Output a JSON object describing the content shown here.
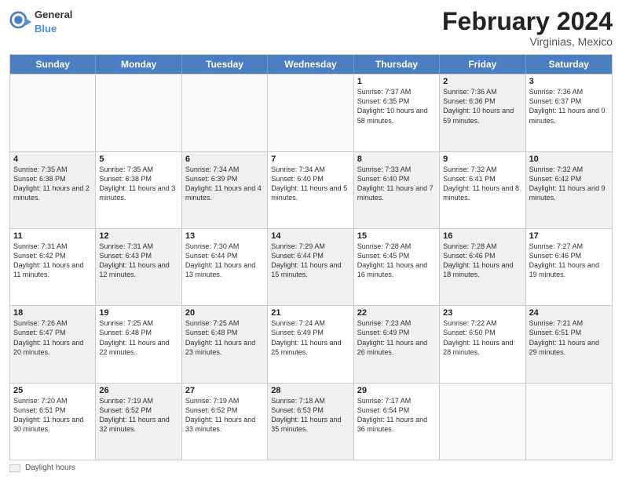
{
  "header": {
    "logo_general": "General",
    "logo_blue": "Blue",
    "month_title": "February 2024",
    "subtitle": "Virginias, Mexico"
  },
  "calendar": {
    "days_of_week": [
      "Sunday",
      "Monday",
      "Tuesday",
      "Wednesday",
      "Thursday",
      "Friday",
      "Saturday"
    ],
    "weeks": [
      [
        {
          "day": "",
          "info": "",
          "empty": true
        },
        {
          "day": "",
          "info": "",
          "empty": true
        },
        {
          "day": "",
          "info": "",
          "empty": true
        },
        {
          "day": "",
          "info": "",
          "empty": true
        },
        {
          "day": "1",
          "info": "Sunrise: 7:37 AM\nSunset: 6:35 PM\nDaylight: 10 hours\nand 58 minutes.",
          "shaded": false
        },
        {
          "day": "2",
          "info": "Sunrise: 7:36 AM\nSunset: 6:36 PM\nDaylight: 10 hours\nand 59 minutes.",
          "shaded": true
        },
        {
          "day": "3",
          "info": "Sunrise: 7:36 AM\nSunset: 6:37 PM\nDaylight: 11 hours\nand 0 minutes.",
          "shaded": false
        }
      ],
      [
        {
          "day": "4",
          "info": "Sunrise: 7:35 AM\nSunset: 6:38 PM\nDaylight: 11 hours\nand 2 minutes.",
          "shaded": true
        },
        {
          "day": "5",
          "info": "Sunrise: 7:35 AM\nSunset: 6:38 PM\nDaylight: 11 hours\nand 3 minutes.",
          "shaded": false
        },
        {
          "day": "6",
          "info": "Sunrise: 7:34 AM\nSunset: 6:39 PM\nDaylight: 11 hours\nand 4 minutes.",
          "shaded": true
        },
        {
          "day": "7",
          "info": "Sunrise: 7:34 AM\nSunset: 6:40 PM\nDaylight: 11 hours\nand 5 minutes.",
          "shaded": false
        },
        {
          "day": "8",
          "info": "Sunrise: 7:33 AM\nSunset: 6:40 PM\nDaylight: 11 hours\nand 7 minutes.",
          "shaded": true
        },
        {
          "day": "9",
          "info": "Sunrise: 7:32 AM\nSunset: 6:41 PM\nDaylight: 11 hours\nand 8 minutes.",
          "shaded": false
        },
        {
          "day": "10",
          "info": "Sunrise: 7:32 AM\nSunset: 6:42 PM\nDaylight: 11 hours\nand 9 minutes.",
          "shaded": true
        }
      ],
      [
        {
          "day": "11",
          "info": "Sunrise: 7:31 AM\nSunset: 6:42 PM\nDaylight: 11 hours\nand 11 minutes.",
          "shaded": false
        },
        {
          "day": "12",
          "info": "Sunrise: 7:31 AM\nSunset: 6:43 PM\nDaylight: 11 hours\nand 12 minutes.",
          "shaded": true
        },
        {
          "day": "13",
          "info": "Sunrise: 7:30 AM\nSunset: 6:44 PM\nDaylight: 11 hours\nand 13 minutes.",
          "shaded": false
        },
        {
          "day": "14",
          "info": "Sunrise: 7:29 AM\nSunset: 6:44 PM\nDaylight: 11 hours\nand 15 minutes.",
          "shaded": true
        },
        {
          "day": "15",
          "info": "Sunrise: 7:28 AM\nSunset: 6:45 PM\nDaylight: 11 hours\nand 16 minutes.",
          "shaded": false
        },
        {
          "day": "16",
          "info": "Sunrise: 7:28 AM\nSunset: 6:46 PM\nDaylight: 11 hours\nand 18 minutes.",
          "shaded": true
        },
        {
          "day": "17",
          "info": "Sunrise: 7:27 AM\nSunset: 6:46 PM\nDaylight: 11 hours\nand 19 minutes.",
          "shaded": false
        }
      ],
      [
        {
          "day": "18",
          "info": "Sunrise: 7:26 AM\nSunset: 6:47 PM\nDaylight: 11 hours\nand 20 minutes.",
          "shaded": true
        },
        {
          "day": "19",
          "info": "Sunrise: 7:25 AM\nSunset: 6:48 PM\nDaylight: 11 hours\nand 22 minutes.",
          "shaded": false
        },
        {
          "day": "20",
          "info": "Sunrise: 7:25 AM\nSunset: 6:48 PM\nDaylight: 11 hours\nand 23 minutes.",
          "shaded": true
        },
        {
          "day": "21",
          "info": "Sunrise: 7:24 AM\nSunset: 6:49 PM\nDaylight: 11 hours\nand 25 minutes.",
          "shaded": false
        },
        {
          "day": "22",
          "info": "Sunrise: 7:23 AM\nSunset: 6:49 PM\nDaylight: 11 hours\nand 26 minutes.",
          "shaded": true
        },
        {
          "day": "23",
          "info": "Sunrise: 7:22 AM\nSunset: 6:50 PM\nDaylight: 11 hours\nand 28 minutes.",
          "shaded": false
        },
        {
          "day": "24",
          "info": "Sunrise: 7:21 AM\nSunset: 6:51 PM\nDaylight: 11 hours\nand 29 minutes.",
          "shaded": true
        }
      ],
      [
        {
          "day": "25",
          "info": "Sunrise: 7:20 AM\nSunset: 6:51 PM\nDaylight: 11 hours\nand 30 minutes.",
          "shaded": false
        },
        {
          "day": "26",
          "info": "Sunrise: 7:19 AM\nSunset: 6:52 PM\nDaylight: 11 hours\nand 32 minutes.",
          "shaded": true
        },
        {
          "day": "27",
          "info": "Sunrise: 7:19 AM\nSunset: 6:52 PM\nDaylight: 11 hours\nand 33 minutes.",
          "shaded": false
        },
        {
          "day": "28",
          "info": "Sunrise: 7:18 AM\nSunset: 6:53 PM\nDaylight: 11 hours\nand 35 minutes.",
          "shaded": true
        },
        {
          "day": "29",
          "info": "Sunrise: 7:17 AM\nSunset: 6:54 PM\nDaylight: 11 hours\nand 36 minutes.",
          "shaded": false
        },
        {
          "day": "",
          "info": "",
          "empty": true
        },
        {
          "day": "",
          "info": "",
          "empty": true
        }
      ]
    ]
  },
  "footer": {
    "box_label": "Daylight hours"
  }
}
